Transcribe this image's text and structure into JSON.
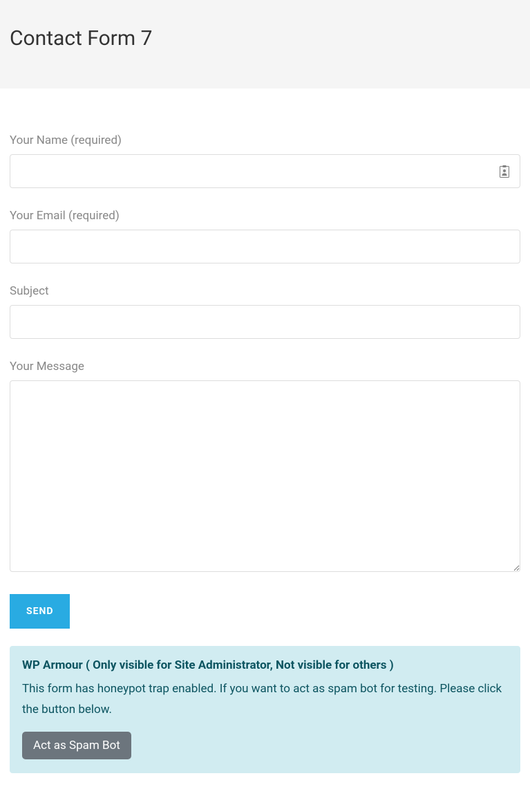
{
  "header": {
    "title": "Contact Form 7"
  },
  "form": {
    "name_label": "Your Name (required)",
    "email_label": "Your Email (required)",
    "subject_label": "Subject",
    "message_label": "Your Message",
    "submit_label": "SEND"
  },
  "admin_notice": {
    "title": "WP Armour ( Only visible for Site Administrator, Not visible for others )",
    "text": "This form has honeypot trap enabled. If you want to act as spam bot for testing. Please click the button below.",
    "button_label": "Act as Spam Bot"
  }
}
